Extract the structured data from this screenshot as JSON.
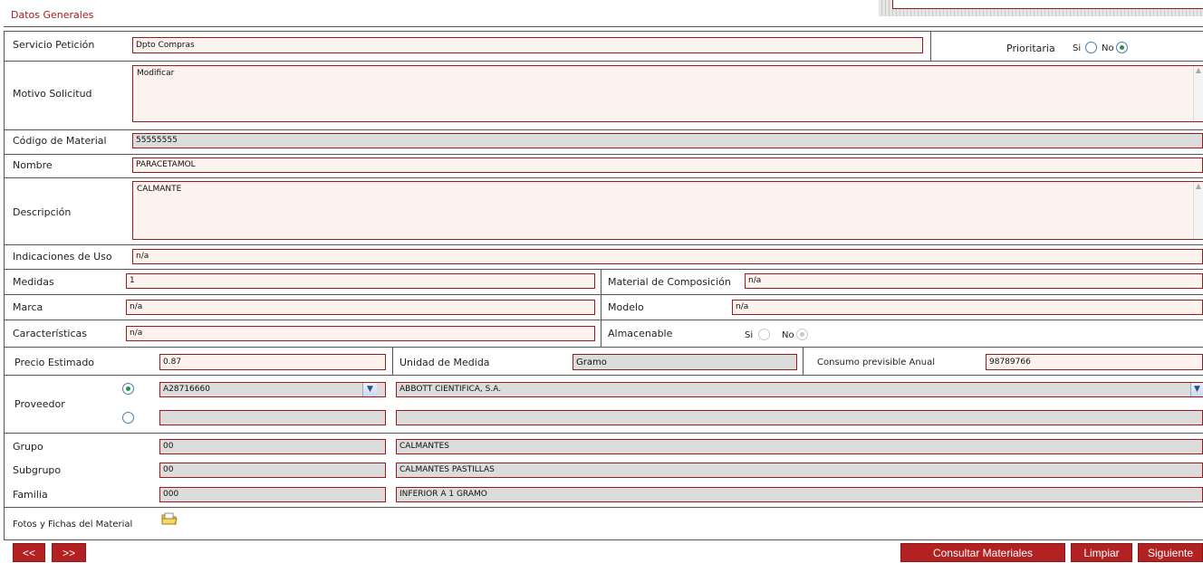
{
  "section_title": "Datos Generales",
  "labels": {
    "servicio": "Servicio Petición",
    "prioritaria": "Prioritaria",
    "si": "Si",
    "no": "No",
    "motivo": "Motivo Solicitud",
    "codigo": "Código de Material",
    "nombre": "Nombre",
    "descripcion": "Descripción",
    "indicaciones": "Indicaciones de Uso",
    "medidas": "Medidas",
    "material_comp": "Material de Composición",
    "marca": "Marca",
    "modelo": "Modelo",
    "caracteristicas": "Características",
    "almacenable": "Almacenable",
    "precio": "Precio Estimado",
    "unidad": "Unidad de Medida",
    "consumo": "Consumo previsible Anual",
    "proveedor": "Proveedor",
    "grupo": "Grupo",
    "subgrupo": "Subgrupo",
    "familia": "Familia",
    "fotos": "Fotos y Fichas del Material"
  },
  "values": {
    "servicio": "Dpto Compras",
    "prioritaria": "No",
    "motivo": "Modificar",
    "codigo": "55555555",
    "nombre": "PARACETAMOL",
    "descripcion": "CALMANTE",
    "indicaciones": "n/a",
    "medidas": "1",
    "material_comp": "n/a",
    "marca": "n/a",
    "modelo": "n/a",
    "caracteristicas": "n/a",
    "almacenable": "No",
    "precio": "0.87",
    "unidad": "Gramo",
    "consumo": "98789766",
    "proveedor1_code": "A28716660",
    "proveedor1_name": "ABBOTT CIENTIFICA, S.A.",
    "proveedor2_code": "",
    "proveedor2_name": "",
    "grupo_code": "00",
    "grupo_name": "CALMANTES",
    "subgrupo_code": "00",
    "subgrupo_name": "CALMANTES PASTILLAS",
    "familia_code": "000",
    "familia_name": "INFERIOR A 1 GRAMO"
  },
  "buttons": {
    "prev": "<<",
    "next_nav": ">>",
    "consultar": "Consultar Materiales",
    "limpiar": "Limpiar",
    "siguiente": "Siguiente"
  },
  "icons": {
    "folder": "folder-icon",
    "dropdown": "chevron-down-icon"
  },
  "colors": {
    "accent": "#b22222",
    "field_border": "#9b1b1b",
    "field_bg": "#fdf3ee",
    "readonly_bg": "#dcdcdc",
    "title": "#9b1b1b"
  }
}
